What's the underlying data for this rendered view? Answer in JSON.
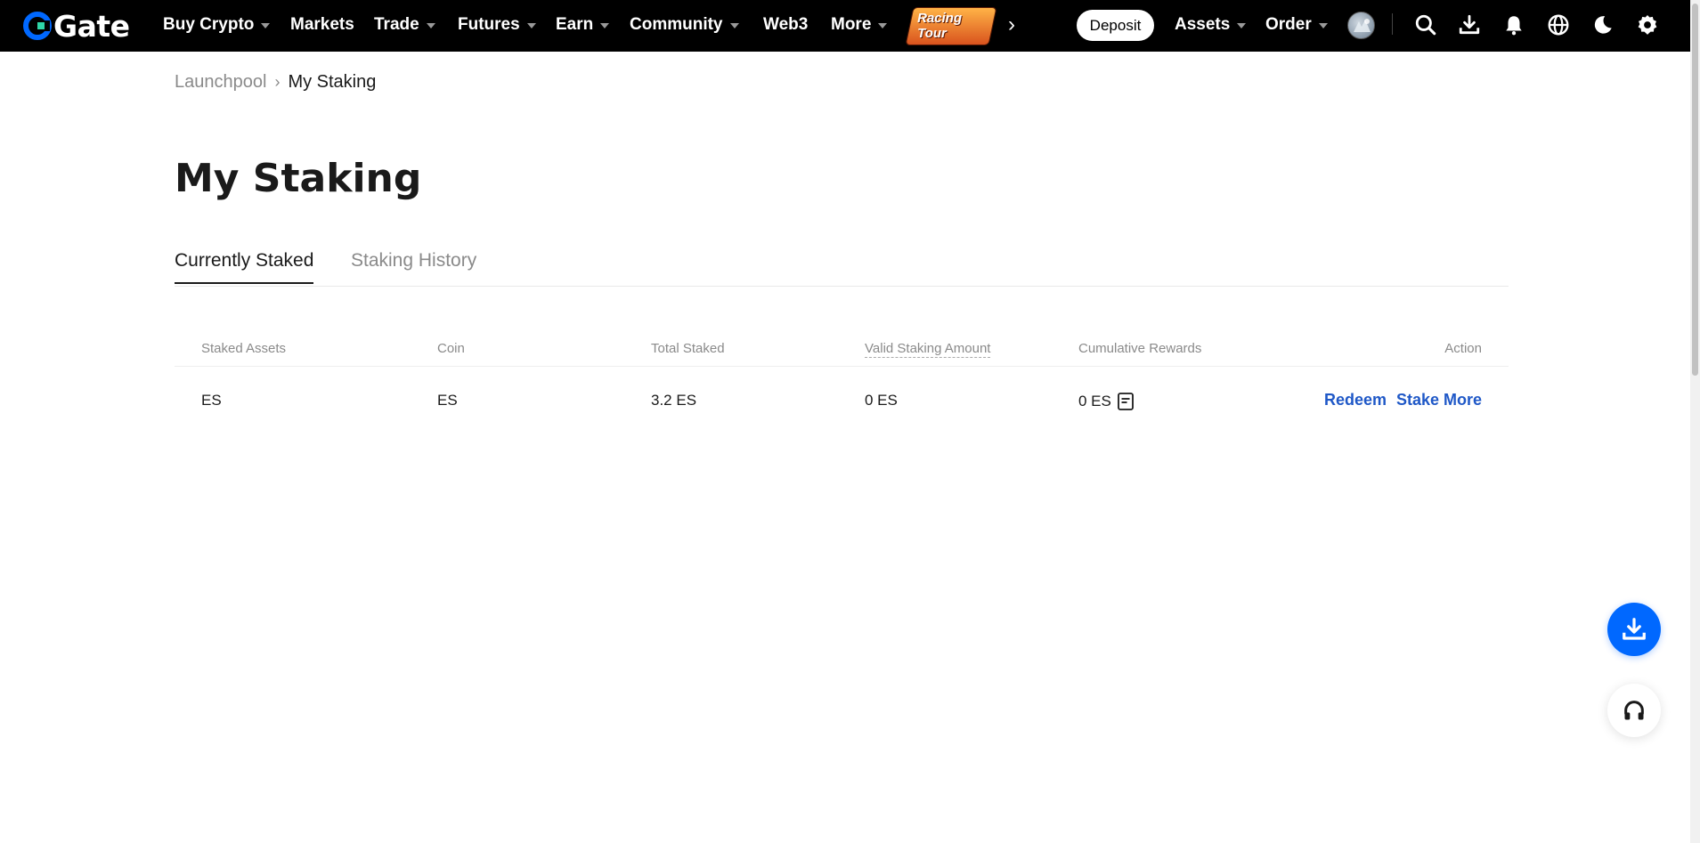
{
  "brand": {
    "name": "Gate",
    "logo_color": "#0068ff"
  },
  "nav": {
    "items": [
      {
        "label": "Buy Crypto",
        "dropdown": true
      },
      {
        "label": "Markets",
        "dropdown": false
      },
      {
        "label": "Trade",
        "dropdown": true
      },
      {
        "label": "Futures",
        "dropdown": true
      },
      {
        "label": "Earn",
        "dropdown": true
      },
      {
        "label": "Community",
        "dropdown": true
      },
      {
        "label": "Web3",
        "dropdown": false
      },
      {
        "label": "More",
        "dropdown": true
      }
    ],
    "promo_label": "Racing Tour",
    "deposit_label": "Deposit",
    "assets_label": "Assets",
    "order_label": "Order",
    "icons": [
      "search-icon",
      "download-icon",
      "bell-icon",
      "globe-icon",
      "moon-icon",
      "gear-icon"
    ]
  },
  "breadcrumb": {
    "parent": "Launchpool",
    "current": "My Staking"
  },
  "page": {
    "title": "My Staking"
  },
  "tabs": [
    {
      "label": "Currently Staked",
      "active": true
    },
    {
      "label": "Staking History",
      "active": false
    }
  ],
  "table": {
    "headers": {
      "staked_assets": "Staked Assets",
      "coin": "Coin",
      "total_staked": "Total Staked",
      "valid_staking_amount": "Valid Staking Amount",
      "cumulative_rewards": "Cumulative Rewards",
      "action": "Action"
    },
    "rows": [
      {
        "staked_assets": "ES",
        "coin": "ES",
        "total_staked": "3.2 ES",
        "valid_staking_amount": "0 ES",
        "cumulative_rewards": "0 ES",
        "actions": [
          "Redeem",
          "Stake More"
        ]
      }
    ]
  },
  "colors": {
    "accent": "#0068ff",
    "link": "#1f58c7",
    "nav_bg": "#000000"
  }
}
